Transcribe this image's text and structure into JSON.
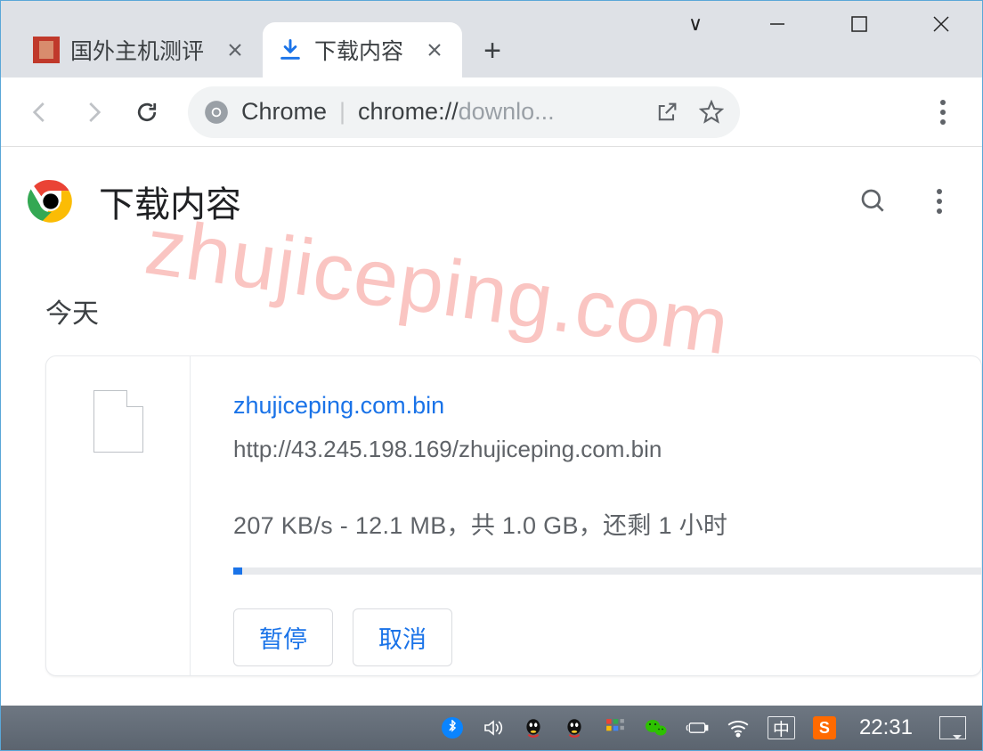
{
  "tabs": [
    {
      "title": "国外主机测评",
      "active": false
    },
    {
      "title": "下载内容",
      "active": true
    }
  ],
  "omnibox": {
    "chrome_label": "Chrome",
    "url_dark": "chrome://",
    "url_light": "downlo..."
  },
  "page": {
    "title": "下载内容",
    "section_label": "今天"
  },
  "download": {
    "filename": "zhujiceping.com.bin",
    "url": "http://43.245.198.169/zhujiceping.com.bin",
    "status": "207 KB/s - 12.1 MB，共 1.0 GB，还剩 1 小时",
    "progress_percent": 1.2,
    "actions": {
      "pause": "暂停",
      "cancel": "取消"
    }
  },
  "watermark": "zhujiceping.com",
  "taskbar": {
    "ime": "中",
    "sogou": "S",
    "clock": "22:31"
  }
}
